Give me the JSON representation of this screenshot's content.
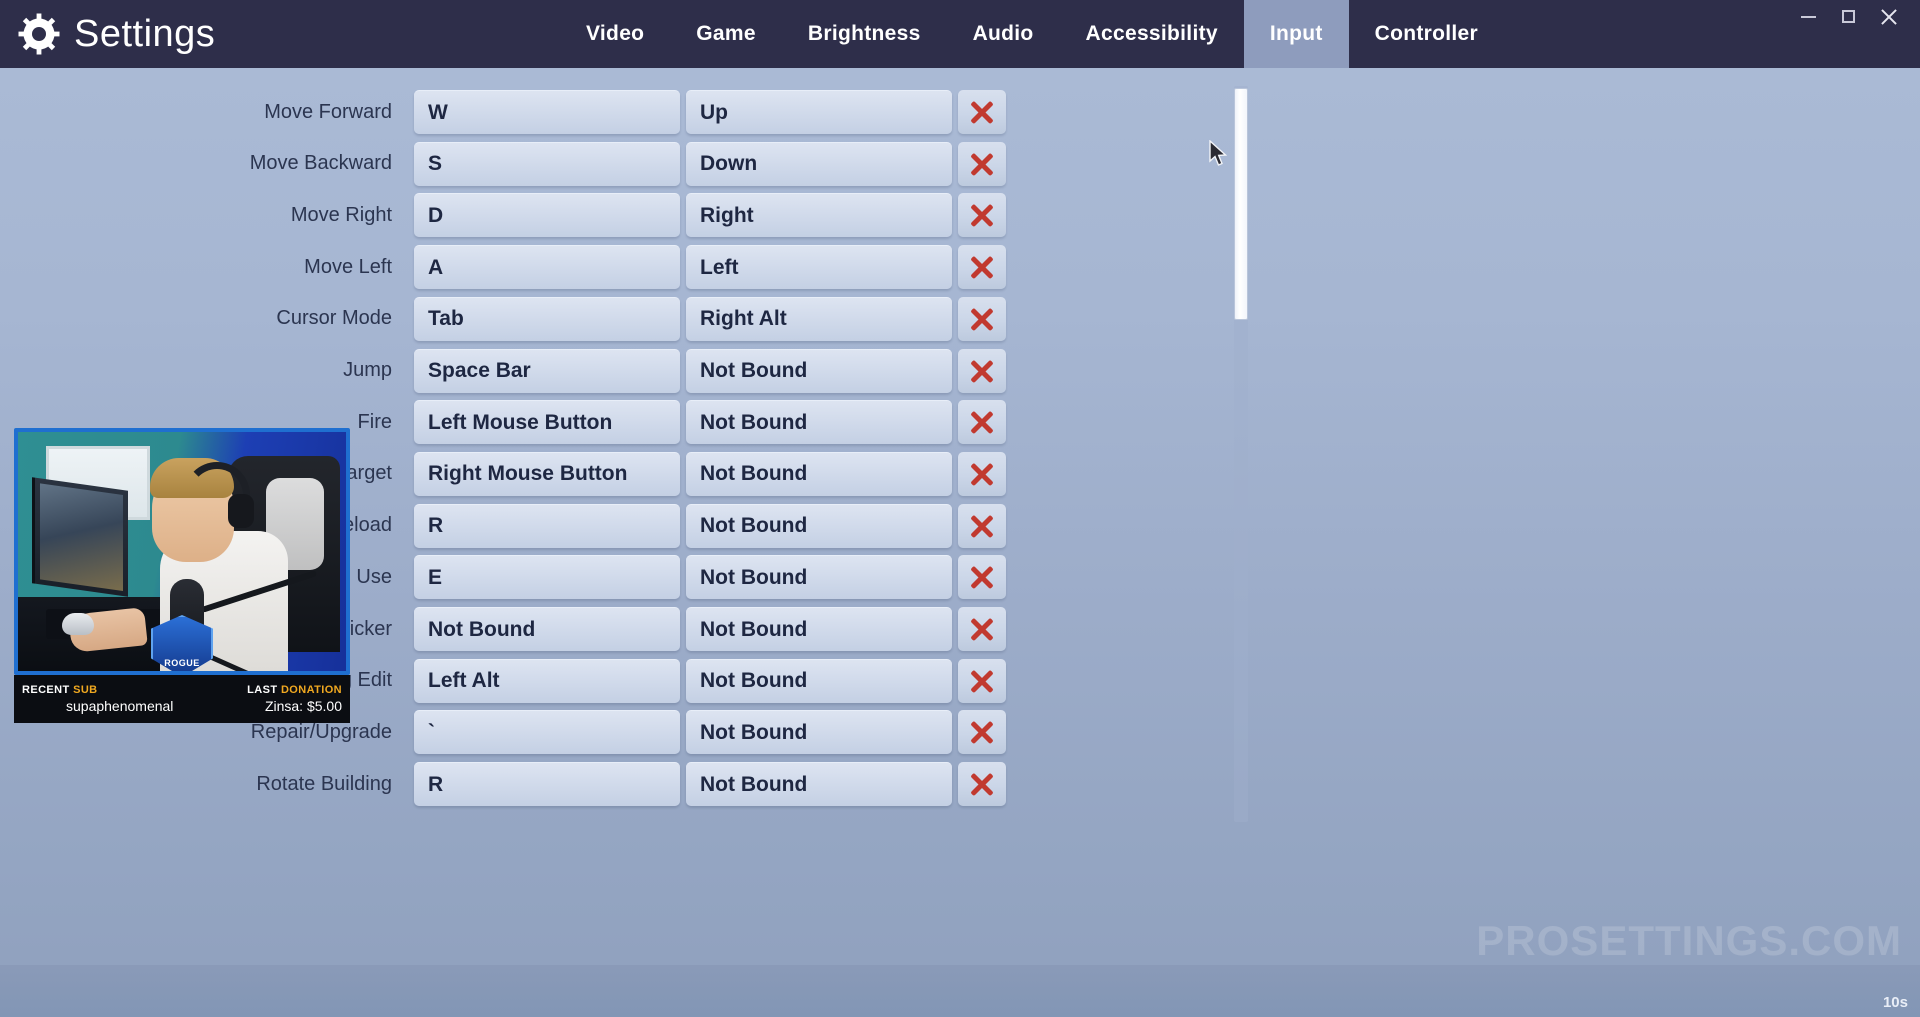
{
  "titlebar": {
    "brand": "Settings",
    "gear_icon": "gear-icon",
    "tabs": [
      {
        "label": "Video",
        "active": false
      },
      {
        "label": "Game",
        "active": false
      },
      {
        "label": "Brightness",
        "active": false
      },
      {
        "label": "Audio",
        "active": false
      },
      {
        "label": "Accessibility",
        "active": false
      },
      {
        "label": "Input",
        "active": true
      },
      {
        "label": "Controller",
        "active": false
      }
    ],
    "window_controls": [
      {
        "name": "minimize-button",
        "icon": "minimize-icon"
      },
      {
        "name": "maximize-button",
        "icon": "maximize-icon"
      },
      {
        "name": "close-button",
        "icon": "close-icon"
      }
    ]
  },
  "keybindings": {
    "clear_icon": "red-x-icon",
    "rows": [
      {
        "action": "Move Forward",
        "primary": "W",
        "secondary": "Up"
      },
      {
        "action": "Move Backward",
        "primary": "S",
        "secondary": "Down"
      },
      {
        "action": "Move Right",
        "primary": "D",
        "secondary": "Right"
      },
      {
        "action": "Move Left",
        "primary": "A",
        "secondary": "Left"
      },
      {
        "action": "Cursor Mode",
        "primary": "Tab",
        "secondary": "Right Alt"
      },
      {
        "action": "Jump",
        "primary": "Space Bar",
        "secondary": "Not Bound"
      },
      {
        "action": "Fire",
        "primary": "Left Mouse Button",
        "secondary": "Not Bound"
      },
      {
        "action": "Target",
        "primary": "Right Mouse Button",
        "secondary": "Not Bound"
      },
      {
        "action": "Reload",
        "primary": "R",
        "secondary": "Not Bound"
      },
      {
        "action": "Use",
        "primary": "E",
        "secondary": "Not Bound"
      },
      {
        "action": "/Picker",
        "primary": "Not Bound",
        "secondary": "Not Bound"
      },
      {
        "action": "Building Edit",
        "primary": "Left Alt",
        "secondary": "Not Bound"
      },
      {
        "action": "Repair/Upgrade",
        "primary": "`",
        "secondary": "Not Bound"
      },
      {
        "action": "Rotate Building",
        "primary": "R",
        "secondary": "Not Bound"
      }
    ]
  },
  "scrollbar": {
    "name": "vertical-scrollbar"
  },
  "cursor": {
    "name": "mouse-cursor"
  },
  "webcam": {
    "logo_text": "ROGUE",
    "recent_sub_label_prefix": "RECENT ",
    "recent_sub_label_accent": "SUB",
    "recent_sub_value": "supaphenomenal",
    "last_donation_label_prefix": "LAST ",
    "last_donation_label_accent": "DONATION",
    "last_donation_value": "Zinsa: $5.00"
  },
  "overlay": {
    "watermark": "PROSETTINGS.COM",
    "timer": "10s"
  },
  "colors": {
    "titlebar": "#2e2e4a",
    "tab_active": "#8e9cbd",
    "field": "#d3dcec",
    "text_dark": "#1e2742",
    "clear_x": "#c1392f",
    "cam_border": "#1f6fd0",
    "accent_orange": "#f0a820"
  }
}
